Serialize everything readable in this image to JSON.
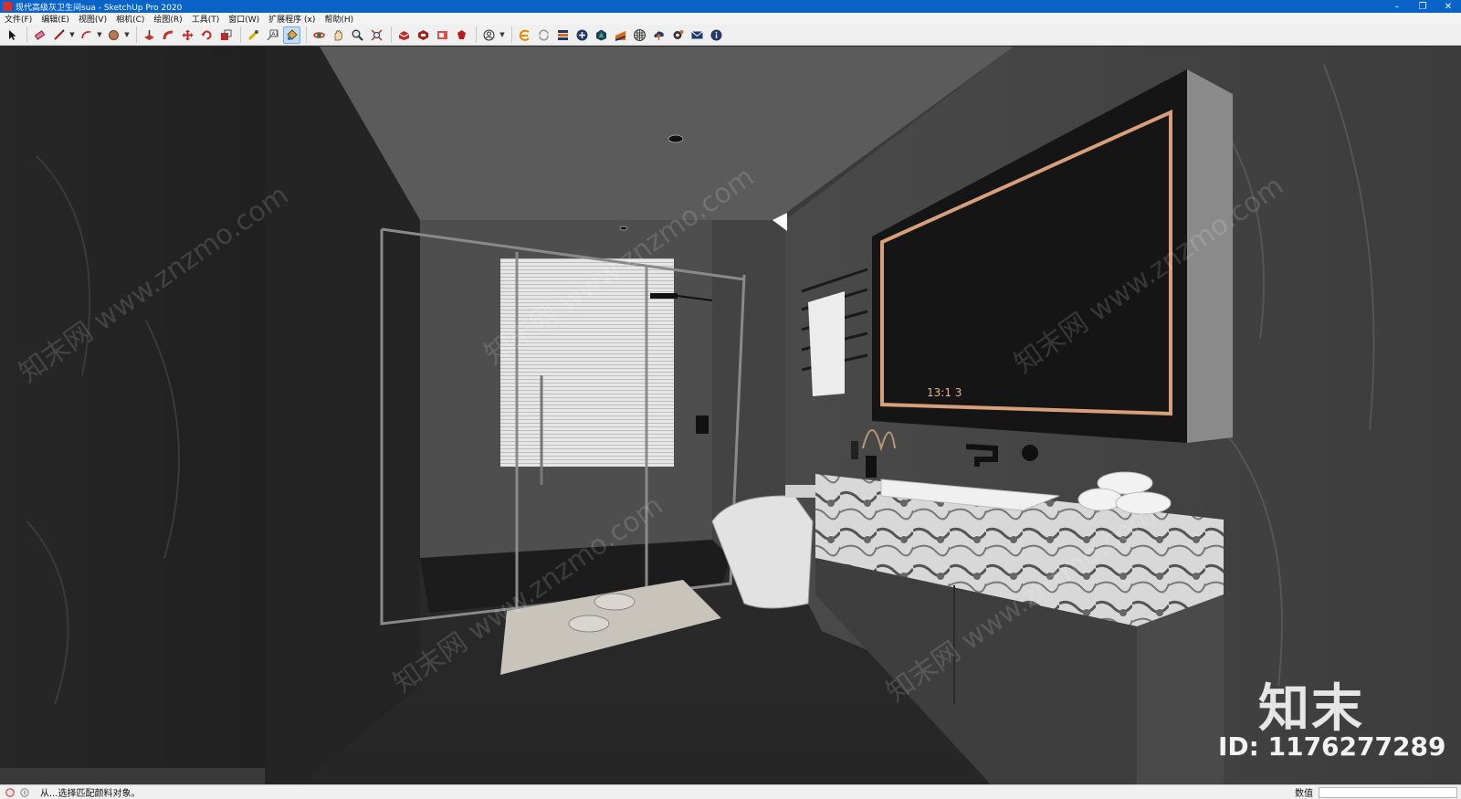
{
  "window": {
    "title": "现代高级灰卫生间sua - SketchUp Pro 2020",
    "controls": {
      "minimize": "–",
      "restore": "❐",
      "close": "✕"
    }
  },
  "menu": [
    "文件(F)",
    "编辑(E)",
    "视图(V)",
    "相机(C)",
    "绘图(R)",
    "工具(T)",
    "窗口(W)",
    "扩展程序 (x)",
    "帮助(H)"
  ],
  "toolbar": {
    "tools": [
      "select-icon",
      "eraser-icon",
      "line-icon",
      "arc-icon",
      "circle-icon",
      "push-pull-icon",
      "follow-me-icon",
      "move-icon",
      "rotate-icon",
      "scale-icon",
      "tape-measure-icon",
      "text-icon",
      "paint-bucket-icon",
      "orbit-icon",
      "pan-icon",
      "zoom-icon",
      "zoom-extents-icon",
      "warehouse-icon",
      "extension-warehouse-icon",
      "layout-icon",
      "ruby-icon",
      "account-icon",
      "plugin-e-icon",
      "refresh-icon",
      "layers-icon",
      "add-icon",
      "tree-icon",
      "roof-icon",
      "pattern-icon",
      "upload-icon",
      "settings-icon",
      "mail-icon",
      "info-icon"
    ],
    "active": "paint-bucket-icon"
  },
  "viewport": {
    "watermark_text": "知末网 www.znzmo.com",
    "mirror_clock": "13:1 3",
    "brand_logo": "知末",
    "brand_id": "ID: 1176277289"
  },
  "status": {
    "message": "从...选择匹配颜料对象。",
    "measurements_label": "数值",
    "measurements_value": ""
  },
  "colors": {
    "titlebar": "#0a64c8",
    "mirror_frame": "#d8a07a",
    "wall_dark": "#2e2e2e",
    "ceiling": "#5b5b5b"
  }
}
